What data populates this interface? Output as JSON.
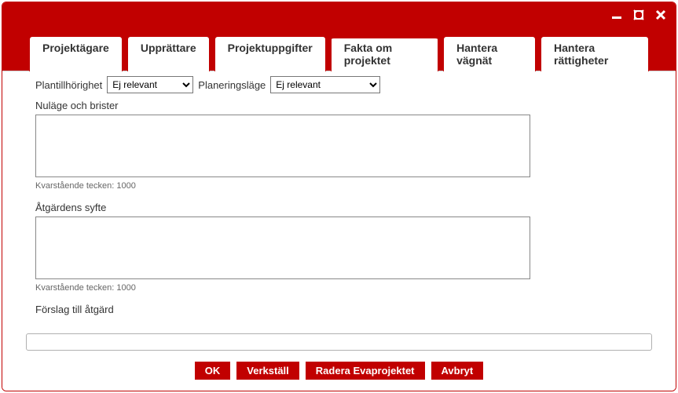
{
  "titlebar": {
    "minimize_title": "Minimera",
    "maximize_title": "Maximera",
    "close_title": "Stäng"
  },
  "tabs": {
    "t0": "Projektägare",
    "t1": "Upprättare",
    "t2": "Projektuppgifter",
    "t3": "Fakta om projektet",
    "t4": "Hantera vägnät",
    "t5": "Hantera rättigheter"
  },
  "form": {
    "plantill_label": "Plantillhörighet",
    "plantill_value": "Ej relevant",
    "planeringslage_label": "Planeringsläge",
    "planeringslage_value": "Ej relevant",
    "nulage_label": "Nuläge och brister",
    "nulage_value": "",
    "nulage_counter": "Kvarstående tecken: 1000",
    "syfte_label": "Åtgärdens syfte",
    "syfte_value": "",
    "syfte_counter": "Kvarstående tecken: 1000",
    "forslag_label": "Förslag till åtgärd"
  },
  "footer": {
    "input_value": ""
  },
  "buttons": {
    "ok": "OK",
    "verkstall": "Verkställ",
    "radera": "Radera Evaprojektet",
    "avbryt": "Avbryt"
  }
}
